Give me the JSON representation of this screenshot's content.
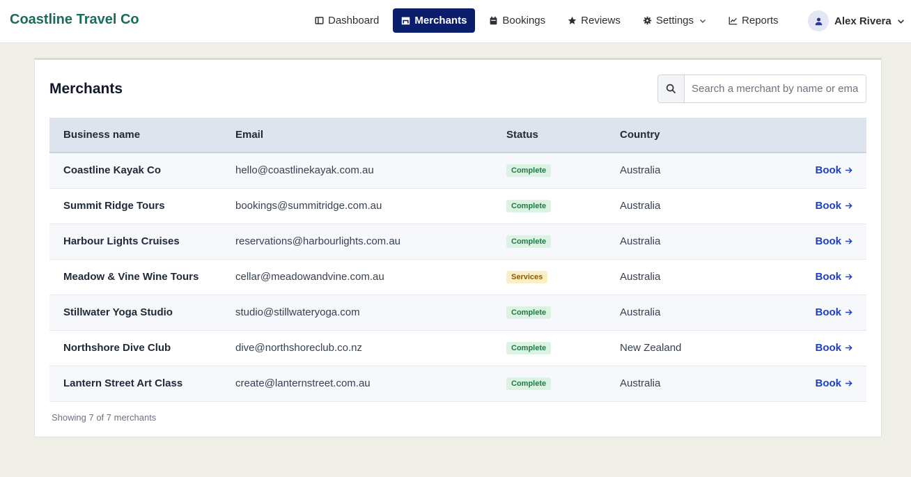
{
  "header": {
    "brand": "Coastline Travel Co",
    "nav": [
      {
        "label": "Dashboard",
        "icon": "dashboard-icon",
        "active": false
      },
      {
        "label": "Merchants",
        "icon": "store-icon",
        "active": true
      },
      {
        "label": "Bookings",
        "icon": "calendar-icon",
        "active": false
      },
      {
        "label": "Reviews",
        "icon": "star-icon",
        "active": false
      },
      {
        "label": "Settings",
        "icon": "gear-icon",
        "active": false
      },
      {
        "label": "Reports",
        "icon": "chart-line-icon",
        "active": false
      }
    ],
    "user": {
      "name": "Alex Rivera"
    }
  },
  "main": {
    "title": "Merchants",
    "search": {
      "placeholder": "Search a merchant by name or email",
      "value": ""
    },
    "table": {
      "columns": [
        "Business name",
        "Email",
        "Status",
        "Country",
        ""
      ],
      "rows": [
        {
          "name": "Coastline Kayak Co",
          "email": "hello@coastlinekayak.com.au",
          "status": "Complete",
          "country": "Australia",
          "action": "Book"
        },
        {
          "name": "Summit Ridge Tours",
          "email": "bookings@summitridge.com.au",
          "status": "Complete",
          "country": "Australia",
          "action": "Book"
        },
        {
          "name": "Harbour Lights Cruises",
          "email": "reservations@harbourlights.com.au",
          "status": "Complete",
          "country": "Australia",
          "action": "Book"
        },
        {
          "name": "Meadow & Vine Wine Tours",
          "email": "cellar@meadowandvine.com.au",
          "status": "Services",
          "country": "Australia",
          "action": "Book"
        },
        {
          "name": "Stillwater Yoga Studio",
          "email": "studio@stillwateryoga.com",
          "status": "Complete",
          "country": "Australia",
          "action": "Book"
        },
        {
          "name": "Northshore Dive Club",
          "email": "dive@northshoreclub.co.nz",
          "status": "Complete",
          "country": "New Zealand",
          "action": "Book"
        },
        {
          "name": "Lantern Street Art Class",
          "email": "create@lanternstreet.com.au",
          "status": "Complete",
          "country": "Australia",
          "action": "Book"
        }
      ]
    },
    "footer_note": "Showing 7 of 7 merchants"
  },
  "colors": {
    "brand": "#1a6b5a",
    "nav_active": "#0b1e6b",
    "link": "#1d3fbf",
    "status_complete_bg": "#dcf3e4",
    "status_services_bg": "#fdefc5"
  }
}
